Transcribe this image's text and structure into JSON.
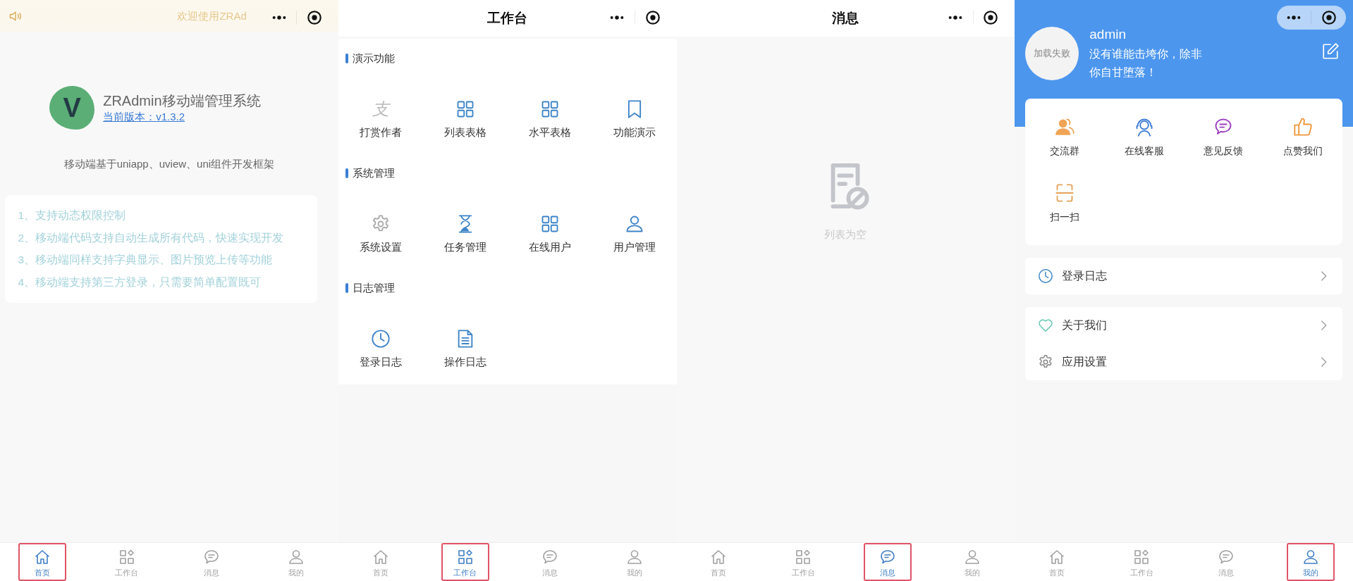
{
  "screens": [
    {
      "kind": "home",
      "notice": "欢迎使用ZRAd",
      "logo_letter": "V",
      "app_title": "ZRAdmin移动端管理系统",
      "version_link": "当前版本：v1.3.2",
      "subtitle": "移动端基于uniapp、uview、uni组件开发框架",
      "features": [
        "1、支持动态权限控制",
        "2、移动端代码支持自动生成所有代码，快速实现开发",
        "3、移动端同样支持字典显示、图片预览上传等功能",
        "4、移动端支持第三方登录，只需要简单配置既可"
      ],
      "tabbar": [
        {
          "label": "首页",
          "kind": "home",
          "selected": true
        },
        {
          "label": "工作台",
          "kind": "apps",
          "selected": false
        },
        {
          "label": "消息",
          "kind": "chat",
          "selected": false
        },
        {
          "label": "我的",
          "kind": "user",
          "selected": false
        }
      ]
    },
    {
      "kind": "workbench",
      "title": "工作台",
      "sections": [
        {
          "title": "演示功能",
          "items": [
            {
              "label": "打赏作者",
              "kind": "glyph",
              "glyph": "支"
            },
            {
              "label": "列表表格",
              "kind": "grid"
            },
            {
              "label": "水平表格",
              "kind": "grid"
            },
            {
              "label": "功能演示",
              "kind": "bookmark"
            }
          ]
        },
        {
          "title": "系统管理",
          "items": [
            {
              "label": "系统设置",
              "kind": "gear"
            },
            {
              "label": "任务管理",
              "kind": "hourglass"
            },
            {
              "label": "在线用户",
              "kind": "grid"
            },
            {
              "label": "用户管理",
              "kind": "user"
            }
          ]
        },
        {
          "title": "日志管理",
          "items": [
            {
              "label": "登录日志",
              "kind": "clock"
            },
            {
              "label": "操作日志",
              "kind": "document"
            }
          ]
        }
      ],
      "tabbar": [
        {
          "label": "首页",
          "kind": "home",
          "selected": false
        },
        {
          "label": "工作台",
          "kind": "apps",
          "selected": true
        },
        {
          "label": "消息",
          "kind": "chat",
          "selected": false
        },
        {
          "label": "我的",
          "kind": "user",
          "selected": false
        }
      ]
    },
    {
      "kind": "messages",
      "title": "消息",
      "empty_text": "列表为空",
      "tabbar": [
        {
          "label": "首页",
          "kind": "home",
          "selected": false
        },
        {
          "label": "工作台",
          "kind": "apps",
          "selected": false
        },
        {
          "label": "消息",
          "kind": "chat",
          "selected": true
        },
        {
          "label": "我的",
          "kind": "user",
          "selected": false
        }
      ]
    },
    {
      "kind": "profile",
      "avatar_text": "加载失败",
      "username": "admin",
      "motto": "没有谁能击垮你，除非你自甘堕落！",
      "shortcuts": [
        {
          "label": "交流群",
          "kind": "group"
        },
        {
          "label": "在线客服",
          "kind": "headset"
        },
        {
          "label": "意见反馈",
          "kind": "chat"
        },
        {
          "label": "点赞我们",
          "kind": "thumb"
        },
        {
          "label": "扫一扫",
          "kind": "scan"
        }
      ],
      "menu_groups": [
        {
          "items": [
            {
              "label": "登录日志",
              "kind": "clock"
            }
          ]
        },
        {
          "items": [
            {
              "label": "关于我们",
              "kind": "heart"
            },
            {
              "label": "应用设置",
              "kind": "gear"
            }
          ]
        }
      ],
      "tabbar": [
        {
          "label": "首页",
          "kind": "home",
          "selected": false
        },
        {
          "label": "工作台",
          "kind": "apps",
          "selected": false
        },
        {
          "label": "消息",
          "kind": "chat",
          "selected": false
        },
        {
          "label": "我的",
          "kind": "user",
          "selected": true
        }
      ]
    }
  ]
}
